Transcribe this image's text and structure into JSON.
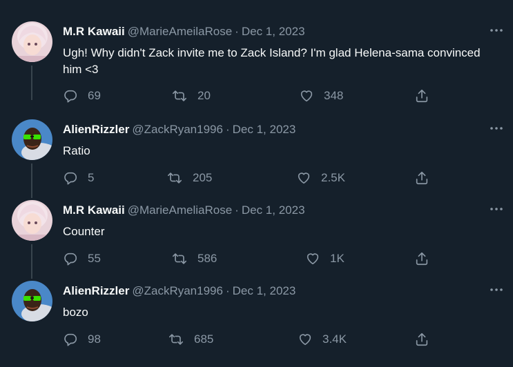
{
  "tweets": [
    {
      "name": "M.R Kawaii",
      "handle": "@MarieAmeilaRose",
      "separator": "·",
      "date": "Dec 1, 2023",
      "text": "Ugh! Why didn't Zack invite me to Zack Island? I'm glad Helena-sama convinced him <3",
      "replies": "69",
      "retweets": "20",
      "likes": "348"
    },
    {
      "name": "AlienRizzler",
      "handle": "@ZackRyan1996",
      "separator": "·",
      "date": "Dec 1, 2023",
      "text": "Ratio",
      "replies": "5",
      "retweets": "205",
      "likes": "2.5K"
    },
    {
      "name": "M.R Kawaii",
      "handle": "@MarieAmeliaRose",
      "separator": "·",
      "date": "Dec 1, 2023",
      "text": "Counter",
      "replies": "55",
      "retweets": "586",
      "likes": "1K"
    },
    {
      "name": "AlienRizzler",
      "handle": "@ZackRyan1996",
      "separator": "·",
      "date": "Dec 1, 2023",
      "text": "bozo",
      "replies": "98",
      "retweets": "685",
      "likes": "3.4K"
    }
  ],
  "colors": {
    "background": "#15202b",
    "primary_text": "#f7f9f9",
    "secondary_text": "#8b98a5",
    "thread_line": "#38444d"
  },
  "icons": {
    "more": "more-icon",
    "reply": "reply-icon",
    "retweet": "retweet-icon",
    "like": "heart-icon",
    "share": "share-icon"
  }
}
